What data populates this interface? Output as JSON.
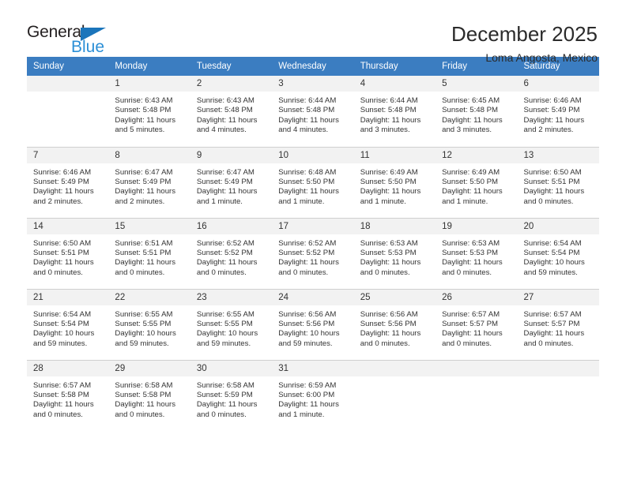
{
  "logo": {
    "text_primary": "General",
    "text_secondary": "Blue",
    "triangle_icon": "triangle-icon",
    "colors": {
      "primary": "#231f20",
      "secondary": "#2b8fd6",
      "triangle": "#1b75bb"
    }
  },
  "header": {
    "title": "December 2025",
    "subtitle": "Loma Angosta, Mexico"
  },
  "theme": {
    "header_bg": "#3b7dc1",
    "header_text": "#ffffff",
    "daynum_bg": "#f2f2f2",
    "cell_border": "#cfcfcf",
    "body_text": "#333333"
  },
  "weekdays": [
    "Sunday",
    "Monday",
    "Tuesday",
    "Wednesday",
    "Thursday",
    "Friday",
    "Saturday"
  ],
  "weeks": [
    [
      {
        "day": "",
        "empty": true,
        "sunrise": "",
        "sunset": "",
        "daylight_line1": "",
        "daylight_line2": ""
      },
      {
        "day": "1",
        "sunrise": "Sunrise: 6:43 AM",
        "sunset": "Sunset: 5:48 PM",
        "daylight_line1": "Daylight: 11 hours",
        "daylight_line2": "and 5 minutes."
      },
      {
        "day": "2",
        "sunrise": "Sunrise: 6:43 AM",
        "sunset": "Sunset: 5:48 PM",
        "daylight_line1": "Daylight: 11 hours",
        "daylight_line2": "and 4 minutes."
      },
      {
        "day": "3",
        "sunrise": "Sunrise: 6:44 AM",
        "sunset": "Sunset: 5:48 PM",
        "daylight_line1": "Daylight: 11 hours",
        "daylight_line2": "and 4 minutes."
      },
      {
        "day": "4",
        "sunrise": "Sunrise: 6:44 AM",
        "sunset": "Sunset: 5:48 PM",
        "daylight_line1": "Daylight: 11 hours",
        "daylight_line2": "and 3 minutes."
      },
      {
        "day": "5",
        "sunrise": "Sunrise: 6:45 AM",
        "sunset": "Sunset: 5:48 PM",
        "daylight_line1": "Daylight: 11 hours",
        "daylight_line2": "and 3 minutes."
      },
      {
        "day": "6",
        "sunrise": "Sunrise: 6:46 AM",
        "sunset": "Sunset: 5:49 PM",
        "daylight_line1": "Daylight: 11 hours",
        "daylight_line2": "and 2 minutes."
      }
    ],
    [
      {
        "day": "7",
        "sunrise": "Sunrise: 6:46 AM",
        "sunset": "Sunset: 5:49 PM",
        "daylight_line1": "Daylight: 11 hours",
        "daylight_line2": "and 2 minutes."
      },
      {
        "day": "8",
        "sunrise": "Sunrise: 6:47 AM",
        "sunset": "Sunset: 5:49 PM",
        "daylight_line1": "Daylight: 11 hours",
        "daylight_line2": "and 2 minutes."
      },
      {
        "day": "9",
        "sunrise": "Sunrise: 6:47 AM",
        "sunset": "Sunset: 5:49 PM",
        "daylight_line1": "Daylight: 11 hours",
        "daylight_line2": "and 1 minute."
      },
      {
        "day": "10",
        "sunrise": "Sunrise: 6:48 AM",
        "sunset": "Sunset: 5:50 PM",
        "daylight_line1": "Daylight: 11 hours",
        "daylight_line2": "and 1 minute."
      },
      {
        "day": "11",
        "sunrise": "Sunrise: 6:49 AM",
        "sunset": "Sunset: 5:50 PM",
        "daylight_line1": "Daylight: 11 hours",
        "daylight_line2": "and 1 minute."
      },
      {
        "day": "12",
        "sunrise": "Sunrise: 6:49 AM",
        "sunset": "Sunset: 5:50 PM",
        "daylight_line1": "Daylight: 11 hours",
        "daylight_line2": "and 1 minute."
      },
      {
        "day": "13",
        "sunrise": "Sunrise: 6:50 AM",
        "sunset": "Sunset: 5:51 PM",
        "daylight_line1": "Daylight: 11 hours",
        "daylight_line2": "and 0 minutes."
      }
    ],
    [
      {
        "day": "14",
        "sunrise": "Sunrise: 6:50 AM",
        "sunset": "Sunset: 5:51 PM",
        "daylight_line1": "Daylight: 11 hours",
        "daylight_line2": "and 0 minutes."
      },
      {
        "day": "15",
        "sunrise": "Sunrise: 6:51 AM",
        "sunset": "Sunset: 5:51 PM",
        "daylight_line1": "Daylight: 11 hours",
        "daylight_line2": "and 0 minutes."
      },
      {
        "day": "16",
        "sunrise": "Sunrise: 6:52 AM",
        "sunset": "Sunset: 5:52 PM",
        "daylight_line1": "Daylight: 11 hours",
        "daylight_line2": "and 0 minutes."
      },
      {
        "day": "17",
        "sunrise": "Sunrise: 6:52 AM",
        "sunset": "Sunset: 5:52 PM",
        "daylight_line1": "Daylight: 11 hours",
        "daylight_line2": "and 0 minutes."
      },
      {
        "day": "18",
        "sunrise": "Sunrise: 6:53 AM",
        "sunset": "Sunset: 5:53 PM",
        "daylight_line1": "Daylight: 11 hours",
        "daylight_line2": "and 0 minutes."
      },
      {
        "day": "19",
        "sunrise": "Sunrise: 6:53 AM",
        "sunset": "Sunset: 5:53 PM",
        "daylight_line1": "Daylight: 11 hours",
        "daylight_line2": "and 0 minutes."
      },
      {
        "day": "20",
        "sunrise": "Sunrise: 6:54 AM",
        "sunset": "Sunset: 5:54 PM",
        "daylight_line1": "Daylight: 10 hours",
        "daylight_line2": "and 59 minutes."
      }
    ],
    [
      {
        "day": "21",
        "sunrise": "Sunrise: 6:54 AM",
        "sunset": "Sunset: 5:54 PM",
        "daylight_line1": "Daylight: 10 hours",
        "daylight_line2": "and 59 minutes."
      },
      {
        "day": "22",
        "sunrise": "Sunrise: 6:55 AM",
        "sunset": "Sunset: 5:55 PM",
        "daylight_line1": "Daylight: 10 hours",
        "daylight_line2": "and 59 minutes."
      },
      {
        "day": "23",
        "sunrise": "Sunrise: 6:55 AM",
        "sunset": "Sunset: 5:55 PM",
        "daylight_line1": "Daylight: 10 hours",
        "daylight_line2": "and 59 minutes."
      },
      {
        "day": "24",
        "sunrise": "Sunrise: 6:56 AM",
        "sunset": "Sunset: 5:56 PM",
        "daylight_line1": "Daylight: 10 hours",
        "daylight_line2": "and 59 minutes."
      },
      {
        "day": "25",
        "sunrise": "Sunrise: 6:56 AM",
        "sunset": "Sunset: 5:56 PM",
        "daylight_line1": "Daylight: 11 hours",
        "daylight_line2": "and 0 minutes."
      },
      {
        "day": "26",
        "sunrise": "Sunrise: 6:57 AM",
        "sunset": "Sunset: 5:57 PM",
        "daylight_line1": "Daylight: 11 hours",
        "daylight_line2": "and 0 minutes."
      },
      {
        "day": "27",
        "sunrise": "Sunrise: 6:57 AM",
        "sunset": "Sunset: 5:57 PM",
        "daylight_line1": "Daylight: 11 hours",
        "daylight_line2": "and 0 minutes."
      }
    ],
    [
      {
        "day": "28",
        "sunrise": "Sunrise: 6:57 AM",
        "sunset": "Sunset: 5:58 PM",
        "daylight_line1": "Daylight: 11 hours",
        "daylight_line2": "and 0 minutes."
      },
      {
        "day": "29",
        "sunrise": "Sunrise: 6:58 AM",
        "sunset": "Sunset: 5:58 PM",
        "daylight_line1": "Daylight: 11 hours",
        "daylight_line2": "and 0 minutes."
      },
      {
        "day": "30",
        "sunrise": "Sunrise: 6:58 AM",
        "sunset": "Sunset: 5:59 PM",
        "daylight_line1": "Daylight: 11 hours",
        "daylight_line2": "and 0 minutes."
      },
      {
        "day": "31",
        "sunrise": "Sunrise: 6:59 AM",
        "sunset": "Sunset: 6:00 PM",
        "daylight_line1": "Daylight: 11 hours",
        "daylight_line2": "and 1 minute."
      },
      {
        "day": "",
        "empty": true,
        "sunrise": "",
        "sunset": "",
        "daylight_line1": "",
        "daylight_line2": ""
      },
      {
        "day": "",
        "empty": true,
        "sunrise": "",
        "sunset": "",
        "daylight_line1": "",
        "daylight_line2": ""
      },
      {
        "day": "",
        "empty": true,
        "sunrise": "",
        "sunset": "",
        "daylight_line1": "",
        "daylight_line2": ""
      }
    ]
  ]
}
